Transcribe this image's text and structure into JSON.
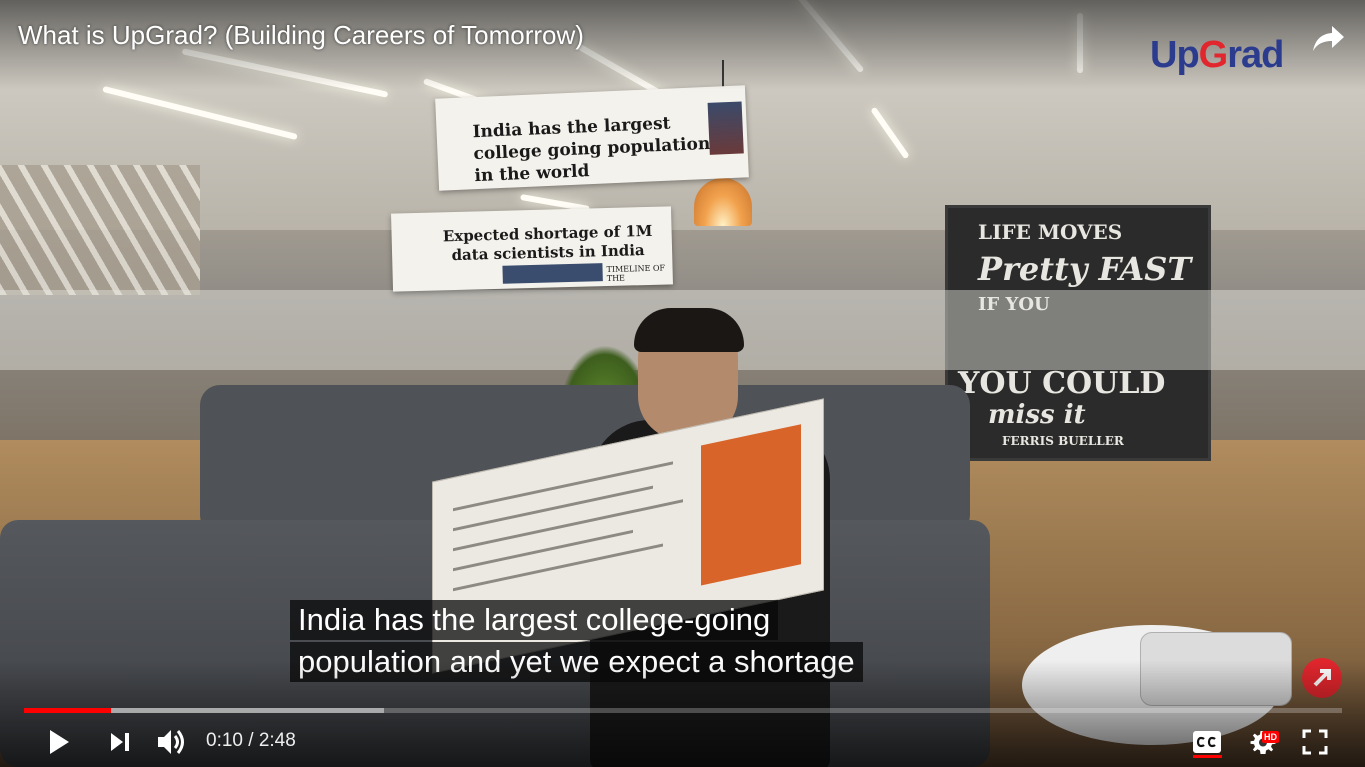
{
  "video": {
    "title": "What is UpGrad? (Building Careers of Tomorrow)",
    "brand_logo": {
      "part1": "Up",
      "part2": "G",
      "part3": "rad"
    },
    "clippings": [
      {
        "headline": "India has the largest college going population in the world"
      },
      {
        "headline": "Expected shortage of 1M data scientists in India",
        "caption": "TIMELINE OF THE"
      }
    ],
    "chalkboard": {
      "line1": "LIFE MOVES",
      "line2": "Pretty FAST",
      "line3": "IF YOU",
      "line4": "YOU COULD",
      "line5": "miss it",
      "line6": "FERRIS BUELLER"
    }
  },
  "captions": {
    "line1": "India has the largest college-going",
    "line2": "population and yet we expect a shortage"
  },
  "player": {
    "progress_played": 0.066,
    "progress_buffered": 0.273,
    "current_time": "0:10",
    "separator": "/",
    "duration": "2:48",
    "hd_badge": "HD",
    "icons": {
      "play": "play-icon",
      "next": "next-icon",
      "volume": "volume-icon",
      "cc": "cc-icon",
      "settings": "gear-icon",
      "fullscreen": "fullscreen-icon",
      "share": "share-icon"
    },
    "accent_color": "#ff0000"
  }
}
